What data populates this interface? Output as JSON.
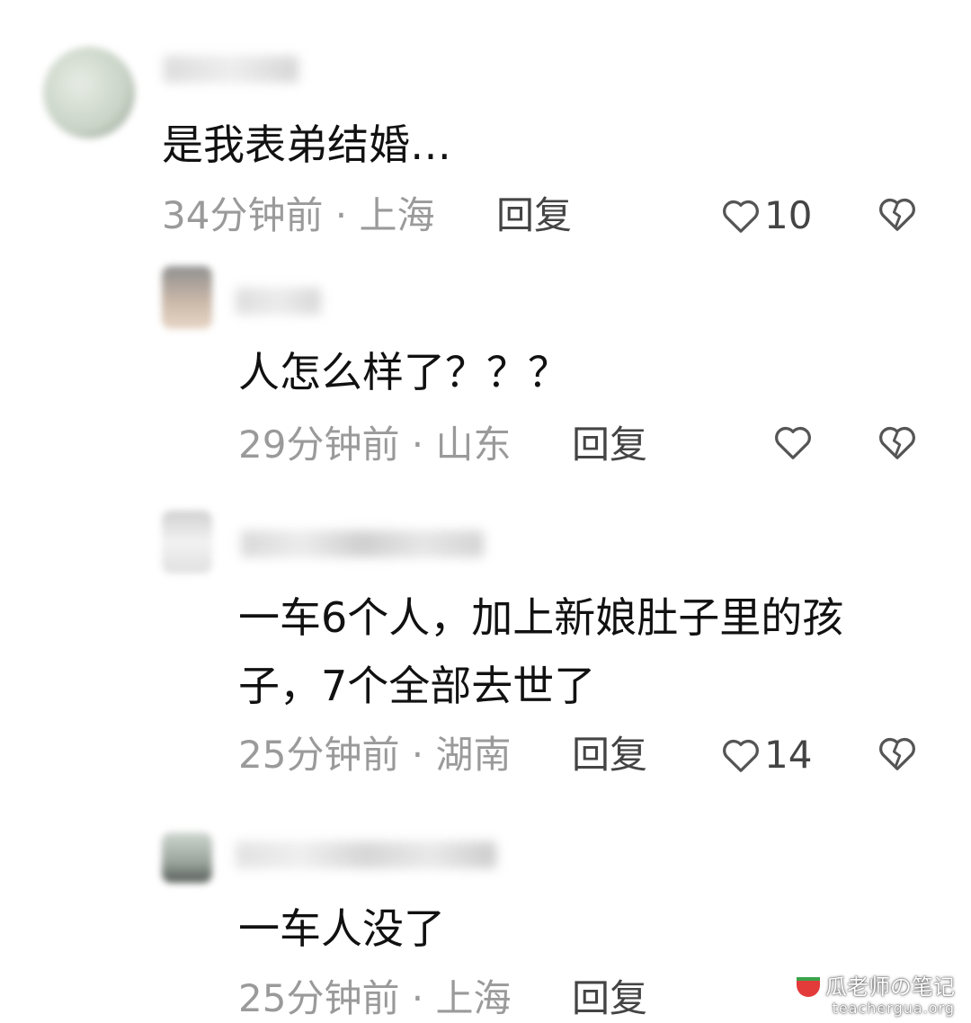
{
  "comments": [
    {
      "content": "是我表弟结婚…",
      "time": "34分钟前 · 上海",
      "reply_label": "回复",
      "likes": "10"
    },
    {
      "content": "人怎么样了？？？",
      "time": "29分钟前 · 山东",
      "reply_label": "回复",
      "likes": ""
    },
    {
      "content_lines": [
        "一车6个人，加上新娘肚子里的孩",
        "子，7个全部去世了"
      ],
      "time": "25分钟前 · 湖南",
      "reply_label": "回复",
      "likes": "14"
    },
    {
      "content": "一车人没了",
      "time": "25分钟前 · 上海",
      "reply_label": "回复",
      "likes": ""
    }
  ],
  "icons": {
    "like": "heart-outline-icon",
    "dislike": "broken-heart-icon"
  },
  "watermark": {
    "title": "瓜老师の笔记",
    "url": "teachergua.org"
  },
  "colors": {
    "content_text": "#111111",
    "meta_text": "#9a9a9a",
    "action_text": "#444444"
  }
}
